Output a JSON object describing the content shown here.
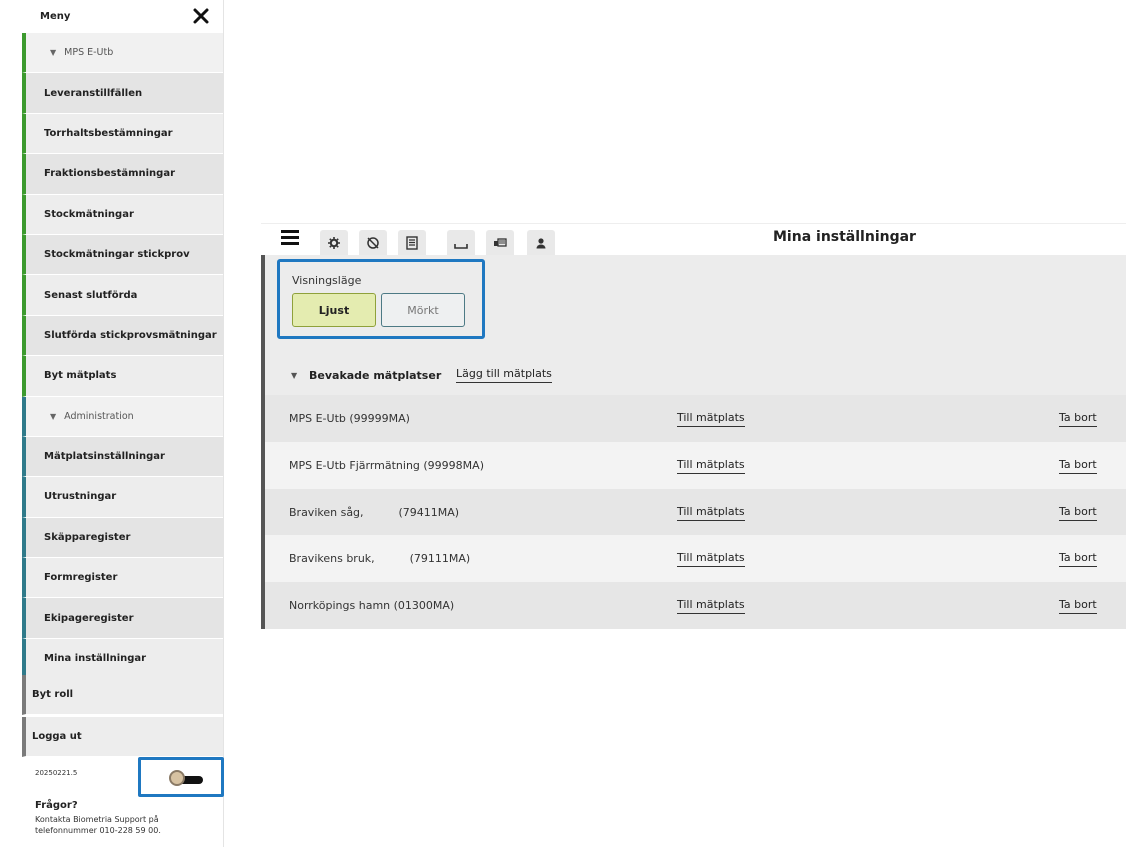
{
  "menu": {
    "title": "Meny",
    "mps_section": "MPS E-Utb",
    "mps_items": [
      "Leveranstillfällen",
      "Torrhaltsbestämningar",
      "Fraktionsbestämningar",
      "Stockmätningar",
      "Stockmätningar stickprov",
      "Senast slutförda",
      "Slutförda stickprovsmätningar",
      "Byt mätplats"
    ],
    "admin_section": "Administration",
    "admin_items": [
      "Mätplatsinställningar",
      "Utrustningar",
      "Skäpparegister",
      "Formregister",
      "Ekipageregister",
      "Mina inställningar"
    ],
    "role": "Byt roll",
    "logout": "Logga ut",
    "version": "20250221.5",
    "help_title": "Frågor?",
    "help_text": "Kontakta Biometria Support på telefonnummer 010-228 59 00."
  },
  "topbar": {
    "title": "Mina inställningar",
    "tools": [
      "gear-icon",
      "no-sync-icon",
      "list-icon",
      "tray-icon",
      "truck-icon",
      "user-icon"
    ]
  },
  "display_mode": {
    "label": "Visningsläge",
    "light": "Ljust",
    "dark": "Mörkt",
    "selected": "Ljust"
  },
  "watched": {
    "title": "Bevakade mätplatser",
    "add_label": "Lägg till mätplats",
    "goto_label": "Till mätplats",
    "remove_label": "Ta bort",
    "rows": [
      "MPS E-Utb (99999MA)",
      "MPS E-Utb Fjärrmätning (99998MA)",
      "Braviken såg,          (79411MA)",
      "Bravikens bruk,          (79111MA)",
      "Norrköpings hamn (01300MA)"
    ]
  },
  "colors": {
    "mps_accent": "#3c9a2e",
    "admin_accent": "#2f7a8a",
    "highlight": "#1f78c1",
    "light_button": "#e4ecb0"
  }
}
